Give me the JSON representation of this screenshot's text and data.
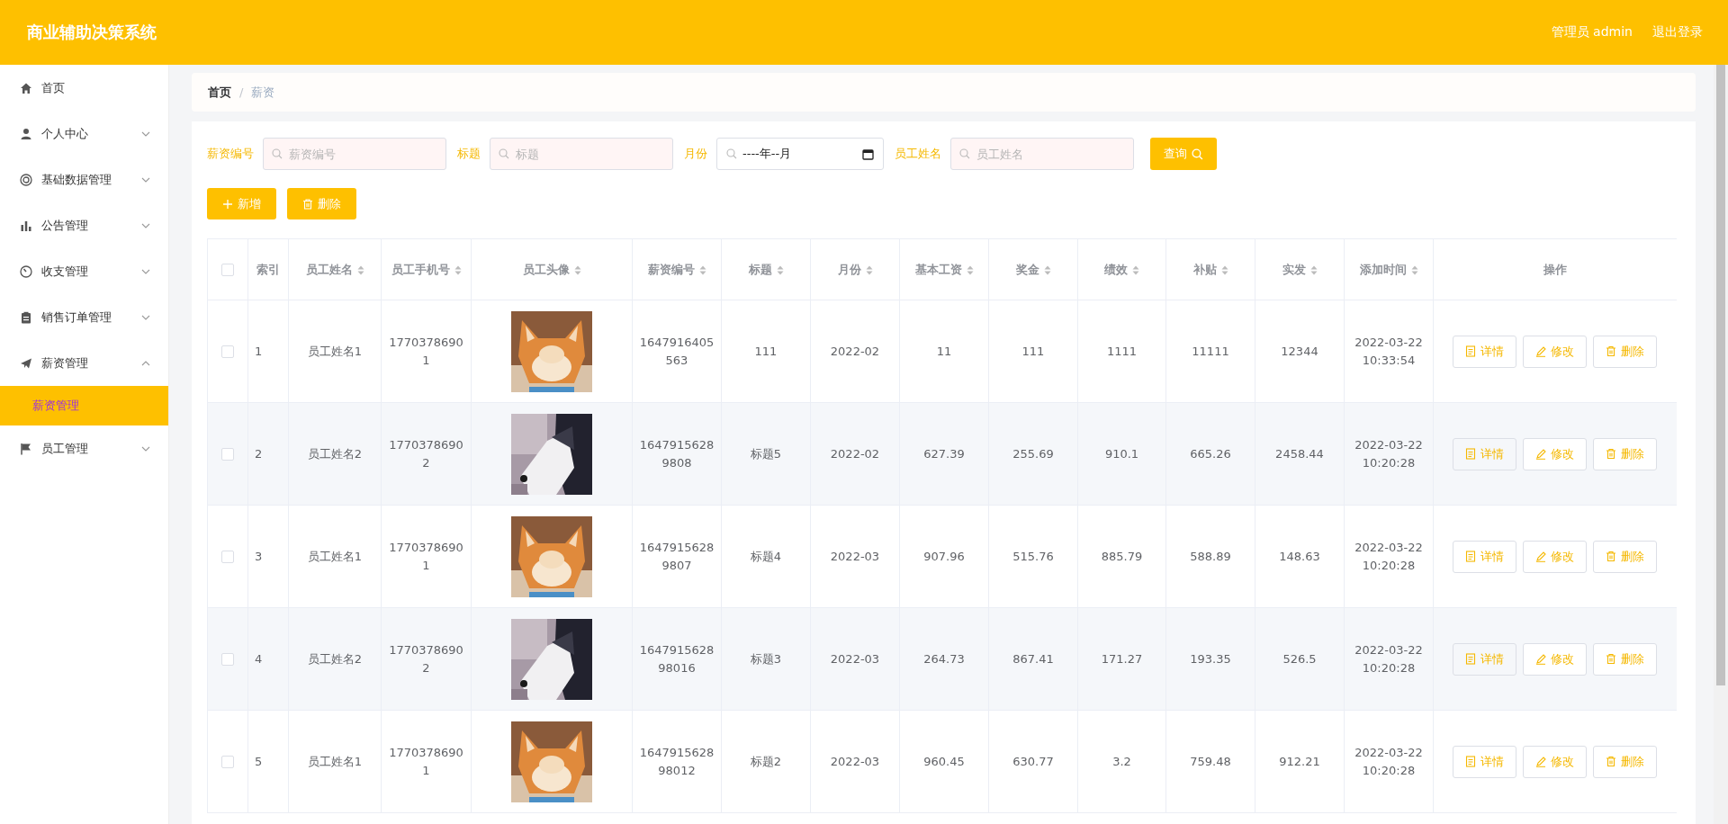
{
  "header": {
    "title": "商业辅助决策系统",
    "user": "管理员 admin",
    "logout": "退出登录"
  },
  "sidebar": {
    "items": [
      {
        "label": "首页",
        "selected": false
      },
      {
        "label": "个人中心",
        "selected": false,
        "expanded": false
      },
      {
        "label": "基础数据管理",
        "selected": false,
        "expanded": false
      },
      {
        "label": "公告管理",
        "selected": false,
        "expanded": false
      },
      {
        "label": "收支管理",
        "selected": false,
        "expanded": false
      },
      {
        "label": "销售订单管理",
        "selected": false,
        "expanded": false
      },
      {
        "label": "薪资管理",
        "selected": false,
        "expanded": true,
        "children": [
          {
            "label": "薪资管理",
            "selected": true
          }
        ]
      },
      {
        "label": "员工管理",
        "selected": false,
        "expanded": false
      }
    ]
  },
  "breadcrumb": {
    "items": [
      "首页",
      "薪资"
    ],
    "separator": "/"
  },
  "search": {
    "fields": [
      {
        "label": "薪资编号",
        "kind": "text",
        "placeholder": "薪资编号"
      },
      {
        "label": "标题",
        "kind": "text",
        "placeholder": "标题"
      },
      {
        "label": "月份",
        "kind": "month",
        "placeholder": "----年--月"
      },
      {
        "label": "员工姓名",
        "kind": "text",
        "placeholder": "员工姓名"
      }
    ],
    "button": "查询"
  },
  "actions": [
    "新增",
    "删除"
  ],
  "table": {
    "select_all": {
      "checked": false
    },
    "columns": [
      {
        "label": "索引",
        "sortable": false
      },
      {
        "label": "员工姓名",
        "sortable": true
      },
      {
        "label": "员工手机号",
        "sortable": true
      },
      {
        "label": "员工头像",
        "sortable": true
      },
      {
        "label": "薪资编号",
        "sortable": true
      },
      {
        "label": "标题",
        "sortable": true
      },
      {
        "label": "月份",
        "sortable": true
      },
      {
        "label": "基本工资",
        "sortable": true
      },
      {
        "label": "奖金",
        "sortable": true
      },
      {
        "label": "绩效",
        "sortable": true
      },
      {
        "label": "补贴",
        "sortable": true
      },
      {
        "label": "实发",
        "sortable": true
      },
      {
        "label": "添加时间",
        "sortable": true
      },
      {
        "label": "操作",
        "sortable": false
      }
    ],
    "rows": [
      {
        "checked": false,
        "index": "1",
        "name": "员工姓名1",
        "phone": "17703786901",
        "avatar": {
          "kind": "picture"
        },
        "salary_no": "1647916405563",
        "title": "111",
        "month": "2022-02",
        "base": "11",
        "bonus": "111",
        "performance": "1111",
        "allowance": "11111",
        "paid": "12344",
        "added": "2022-03-22 10:33:54",
        "buttons": [
          "详情",
          "修改",
          "删除"
        ]
      },
      {
        "checked": false,
        "index": "2",
        "name": "员工姓名2",
        "phone": "17703786902",
        "avatar": {
          "kind": "picture"
        },
        "salary_no": "16479156289808",
        "title": "标题5",
        "month": "2022-02",
        "base": "627.39",
        "bonus": "255.69",
        "performance": "910.1",
        "allowance": "665.26",
        "paid": "2458.44",
        "added": "2022-03-22 10:20:28",
        "buttons": [
          "详情",
          "修改",
          "删除"
        ]
      },
      {
        "checked": false,
        "index": "3",
        "name": "员工姓名1",
        "phone": "17703786901",
        "avatar": {
          "kind": "picture"
        },
        "salary_no": "16479156289807",
        "title": "标题4",
        "month": "2022-03",
        "base": "907.96",
        "bonus": "515.76",
        "performance": "885.79",
        "allowance": "588.89",
        "paid": "148.63",
        "added": "2022-03-22 10:20:28",
        "buttons": [
          "详情",
          "修改",
          "删除"
        ]
      },
      {
        "checked": false,
        "index": "4",
        "name": "员工姓名2",
        "phone": "17703786902",
        "avatar": {
          "kind": "picture"
        },
        "salary_no": "164791562898016",
        "title": "标题3",
        "month": "2022-03",
        "base": "264.73",
        "bonus": "867.41",
        "performance": "171.27",
        "allowance": "193.35",
        "paid": "526.5",
        "added": "2022-03-22 10:20:28",
        "buttons": [
          "详情",
          "修改",
          "删除"
        ]
      },
      {
        "checked": false,
        "index": "5",
        "name": "员工姓名1",
        "phone": "17703786901",
        "avatar": {
          "kind": "picture"
        },
        "salary_no": "164791562898012",
        "title": "标题2",
        "month": "2022-03",
        "base": "960.45",
        "bonus": "630.77",
        "performance": "3.2",
        "allowance": "759.48",
        "paid": "912.21",
        "added": "2022-03-22 10:20:28",
        "buttons": [
          "详情",
          "修改",
          "删除"
        ]
      }
    ]
  }
}
